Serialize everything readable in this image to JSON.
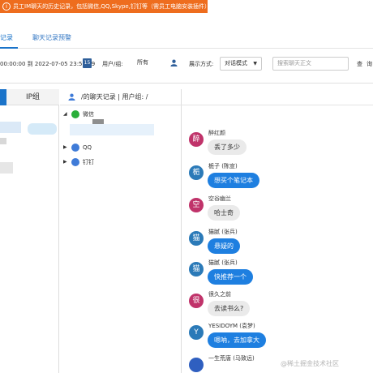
{
  "banner": {
    "icon": "i",
    "text": "员工IM聊天的历史记录，包括微信,QQ,Skype,钉钉等（需员工电脑安装插件）",
    "color": "#ee6d1e"
  },
  "tabs": [
    {
      "label": "记录"
    },
    {
      "label": "聊天记录预警"
    }
  ],
  "filter": {
    "date_range": "00:00:00 到 2022-07-05 23:59:59",
    "calendar_icon": "15",
    "user_group_label": "用户/组:",
    "user_group_value": "所有",
    "display_label": "展示方式:",
    "display_value": "对话模式",
    "search_placeholder": "搜索聊天正文",
    "query_button": "查",
    "extra_button": "询"
  },
  "left_panel": {
    "tab_ip": "IP组"
  },
  "tree": {
    "header": "/的聊天记录  |  用户组: /",
    "nodes": [
      {
        "label": "微信",
        "icon": "wechat-icon",
        "color": "#2aae3a"
      },
      {
        "label": "QQ",
        "icon": "qq-icon",
        "color": "#3f7bd8"
      },
      {
        "label": "钉钉",
        "icon": "dingtalk-icon",
        "color": "#3f7bd8"
      }
    ]
  },
  "messages": [
    {
      "avatar": "醉",
      "color": "#c0336a",
      "sender": "醉红颜",
      "text": "丢了多少",
      "bubble": "grey"
    },
    {
      "avatar": "栀",
      "color": "#2b7ab8",
      "sender": "栀子 (陈宣)",
      "text": "想买个笔记本",
      "bubble": "blue"
    },
    {
      "avatar": "空",
      "color": "#c0336a",
      "sender": "空谷幽兰",
      "text": "哈士奇",
      "bubble": "grey"
    },
    {
      "avatar": "猫",
      "color": "#2b7ab8",
      "sender": "猫腻 (张兵)",
      "text": "悬疑的",
      "bubble": "blue"
    },
    {
      "avatar": "猫",
      "color": "#2b7ab8",
      "sender": "猫腻 (张兵)",
      "text": "快推荐一个",
      "bubble": "blue"
    },
    {
      "avatar": "很",
      "color": "#c0336a",
      "sender": "很久之前",
      "text": "去读书么?",
      "bubble": "grey"
    },
    {
      "avatar": "Y",
      "color": "#2b7ab8",
      "sender": "YESIDOYM (袁梦)",
      "text": "嗯呐，去加拿大",
      "bubble": "blue"
    },
    {
      "avatar": "",
      "color": "#2f5fc0",
      "sender": "一生荒唐 (马致远)",
      "text": "",
      "bubble": "none"
    }
  ],
  "watermark": "@稀土掘金技术社区"
}
